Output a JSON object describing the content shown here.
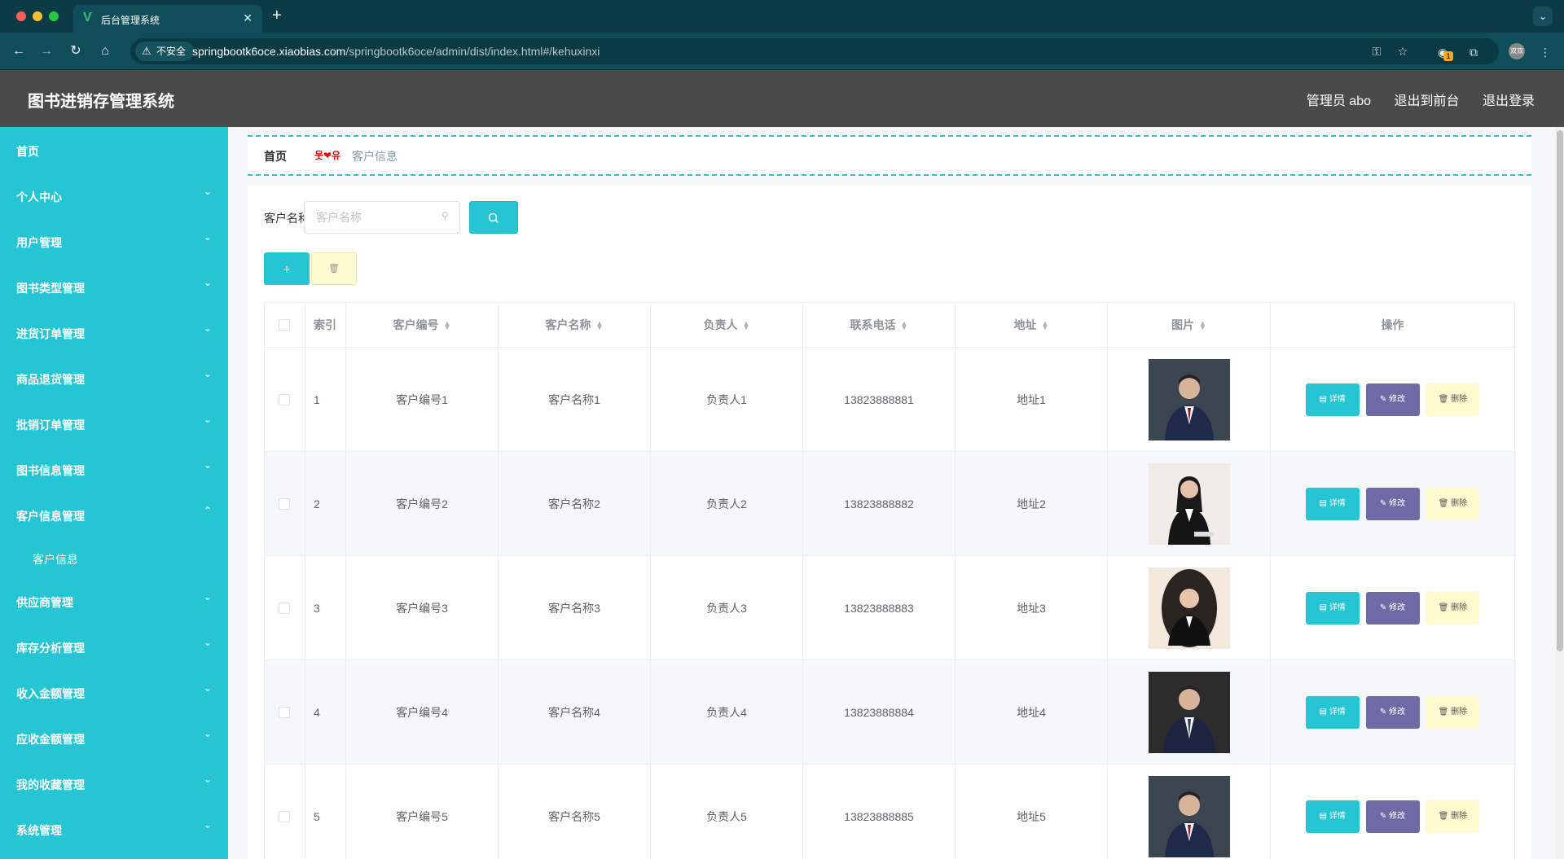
{
  "browser": {
    "tab_title": "后台管理系统",
    "tab_close": "✕",
    "new_tab": "+",
    "insecure_label": "不安全",
    "url_host": "springbootk6oce.xiaobias.com",
    "url_path": "/springbootk6oce/admin/dist/index.html#/kehuxinxi",
    "ext_badge": "1",
    "profile_label": "双双"
  },
  "header": {
    "title": "图书进销存管理系统",
    "user": "管理员 abo",
    "to_front": "退出到前台",
    "logout": "退出登录"
  },
  "sidebar": {
    "items": [
      {
        "label": "首页"
      },
      {
        "label": "个人中心"
      },
      {
        "label": "用户管理"
      },
      {
        "label": "图书类型管理"
      },
      {
        "label": "进货订单管理"
      },
      {
        "label": "商品退货管理"
      },
      {
        "label": "批销订单管理"
      },
      {
        "label": "图书信息管理"
      },
      {
        "label": "客户信息管理"
      },
      {
        "label": "供应商管理"
      },
      {
        "label": "库存分析管理"
      },
      {
        "label": "收入金额管理"
      },
      {
        "label": "应收金额管理"
      },
      {
        "label": "我的收藏管理"
      },
      {
        "label": "系统管理"
      }
    ],
    "submenu": {
      "label": "客户信息"
    }
  },
  "breadcrumb": {
    "home": "首页",
    "separator": "웃❤유",
    "current": "客户信息"
  },
  "search": {
    "label": "客户名称",
    "placeholder": "客户名称"
  },
  "table": {
    "headers": {
      "index": "索引",
      "code": "客户编号",
      "name": "客户名称",
      "contact": "负责人",
      "phone": "联系电话",
      "address": "地址",
      "image": "图片",
      "actions": "操作"
    },
    "rows": [
      {
        "index": "1",
        "code": "客户编号1",
        "name": "客户名称1",
        "contact": "负责人1",
        "phone": "13823888881",
        "address": "地址1"
      },
      {
        "index": "2",
        "code": "客户编号2",
        "name": "客户名称2",
        "contact": "负责人2",
        "phone": "13823888882",
        "address": "地址2"
      },
      {
        "index": "3",
        "code": "客户编号3",
        "name": "客户名称3",
        "contact": "负责人3",
        "phone": "13823888883",
        "address": "地址3"
      },
      {
        "index": "4",
        "code": "客户编号4",
        "name": "客户名称4",
        "contact": "负责人4",
        "phone": "13823888884",
        "address": "地址4"
      },
      {
        "index": "5",
        "code": "客户编号5",
        "name": "客户名称5",
        "contact": "负责人5",
        "phone": "13823888885",
        "address": "地址5"
      }
    ],
    "action_labels": {
      "detail": "详情",
      "edit": "修改",
      "delete": "删除"
    }
  },
  "colors": {
    "accent": "#26c5d3",
    "header_bg": "#4a4a4a",
    "edit": "#6e6aa8",
    "delete_bg": "#fffbd0"
  }
}
